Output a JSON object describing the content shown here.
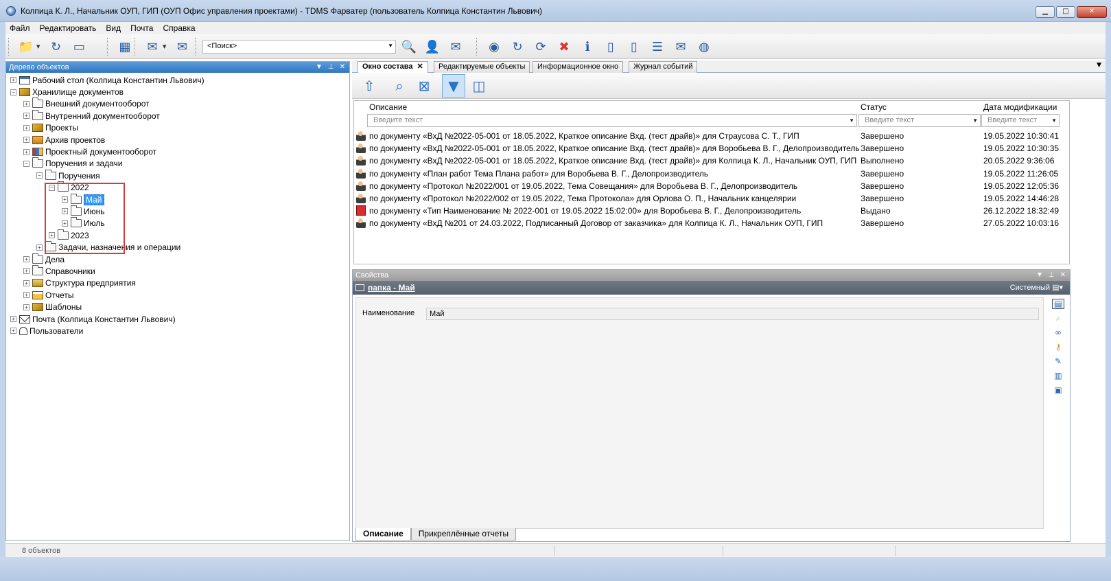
{
  "window": {
    "title": "Колпица К. Л., Начальник ОУП, ГИП (ОУП Офис управления проектами) - TDMS Фарватер (пользователь Колпица Константин Львович)",
    "minimize": "▁",
    "maximize": "□",
    "close": "✕"
  },
  "menu": [
    "Файл",
    "Редактировать",
    "Вид",
    "Почта",
    "Справка"
  ],
  "toolbar": {
    "search_text": "<Поиск>"
  },
  "tree_panel": {
    "title": "Дерево объектов",
    "items": [
      {
        "label": "Рабочий стол (Колпица Константин Львович)",
        "exp": "+"
      },
      {
        "label": "Хранилище документов",
        "exp": "−"
      },
      {
        "label": "Внешний документооборот",
        "exp": "+"
      },
      {
        "label": "Внутренний документооборот",
        "exp": "+"
      },
      {
        "label": "Проекты",
        "exp": "+"
      },
      {
        "label": "Архив проектов",
        "exp": "+"
      },
      {
        "label": "Проектный документооборот",
        "exp": "+"
      },
      {
        "label": "Поручения и задачи",
        "exp": "−"
      },
      {
        "label": "Поручения",
        "exp": "−"
      },
      {
        "label": "2022",
        "exp": "−"
      },
      {
        "label": "Май",
        "exp": "+"
      },
      {
        "label": "Июнь",
        "exp": "+"
      },
      {
        "label": "Июль",
        "exp": "+"
      },
      {
        "label": "2023",
        "exp": "+"
      },
      {
        "label": "Задачи, назначения и операции",
        "exp": "+"
      },
      {
        "label": "Дела",
        "exp": "+"
      },
      {
        "label": "Справочники",
        "exp": "+"
      },
      {
        "label": "Структура предприятия",
        "exp": "+"
      },
      {
        "label": "Отчеты",
        "exp": "+"
      },
      {
        "label": "Шаблоны",
        "exp": "+"
      },
      {
        "label": "Почта (Колпица Константин Львович)",
        "exp": "+"
      },
      {
        "label": "Пользователи",
        "exp": "+"
      }
    ]
  },
  "tabs": [
    {
      "label": "Окно состава",
      "close": "✕"
    },
    {
      "label": "Редактируемые объекты"
    },
    {
      "label": "Информационное окно"
    },
    {
      "label": "Журнал событий"
    }
  ],
  "grid": {
    "columns": [
      "Описание",
      "Статус",
      "Дата модификации"
    ],
    "filter_placeholder": "Введите текст",
    "rows": [
      {
        "desc": "по документу «ВхД №2022-05-001 от 18.05.2022, Краткое описание Вхд. (тест драйв)» для Страусова С. Т., ГИП",
        "status": "Завершено",
        "date": "19.05.2022 10:30:41",
        "icon": "task"
      },
      {
        "desc": "по документу «ВхД №2022-05-001 от 18.05.2022, Краткое описание Вхд. (тест драйв)» для Воробьева В. Г., Делопроизводитель",
        "status": "Завершено",
        "date": "19.05.2022 10:30:35",
        "icon": "task"
      },
      {
        "desc": "по документу «ВхД №2022-05-001 от 18.05.2022, Краткое описание Вхд. (тест драйв)» для Колпица К. Л., Начальник ОУП, ГИП",
        "status": "Выполнено",
        "date": "20.05.2022 9:36:06",
        "icon": "task"
      },
      {
        "desc": "по документу «План работ Тема Плана работ» для Воробьева В. Г., Делопроизводитель",
        "status": "Завершено",
        "date": "19.05.2022 11:26:05",
        "icon": "task"
      },
      {
        "desc": "по документу «Протокол №2022/001 от 19.05.2022, Тема Совещания» для Воробьева В. Г., Делопроизводитель",
        "status": "Завершено",
        "date": "19.05.2022 12:05:36",
        "icon": "task"
      },
      {
        "desc": "по документу «Протокол №2022/002 от 19.05.2022, Тема Протокола» для Орлова О. П., Начальник канцелярии",
        "status": "Завершено",
        "date": "19.05.2022 14:46:28",
        "icon": "task"
      },
      {
        "desc": "по документу «Тип Наименование № 2022-001 от 19.05.2022 15:02:00» для Воробьева В. Г., Делопроизводитель",
        "status": "Выдано",
        "date": "26.12.2022 18:32:49",
        "icon": "issued"
      },
      {
        "desc": "по документу «ВхД №201 от 24.03.2022, Подписанный Договор от заказчика» для Колпица К. Л., Начальник ОУП, ГИП",
        "status": "Завершено",
        "date": "27.05.2022 10:03:16",
        "icon": "task"
      }
    ]
  },
  "properties": {
    "title": "Свойства",
    "object_link": "папка - Май",
    "view_mode": "Системный",
    "field_label": "Наименование",
    "field_value": "Май",
    "bottom_tabs": [
      "Описание",
      "Прикреплённые отчеты"
    ]
  },
  "status": {
    "count": "8 объектов"
  }
}
